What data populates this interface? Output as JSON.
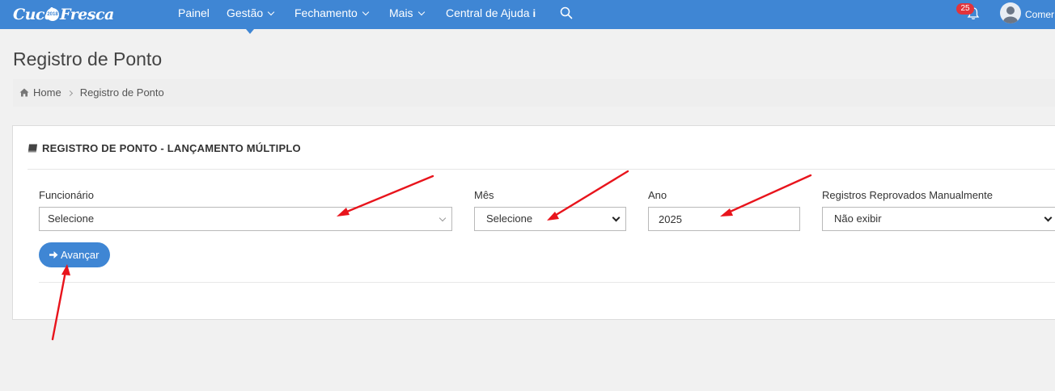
{
  "brand": {
    "logo_part1": "Cucá",
    "logo_badge": "2018",
    "logo_part2": "Fresca"
  },
  "nav": {
    "items": [
      {
        "label": "Painel"
      },
      {
        "label": "Gestão"
      },
      {
        "label": "Fechamento"
      },
      {
        "label": "Mais"
      },
      {
        "label": "Central de Ajuda"
      }
    ],
    "info_glyph": "i"
  },
  "header": {
    "notification_count": "25",
    "user_name": "Comer"
  },
  "page": {
    "title": "Registro de Ponto"
  },
  "breadcrumb": {
    "home": "Home",
    "current": "Registro de Ponto"
  },
  "panel": {
    "title": "REGISTRO DE PONTO - LANÇAMENTO MÚLTIPLO",
    "fields": {
      "funcionario": {
        "label": "Funcionário",
        "value": "Selecione"
      },
      "mes": {
        "label": "Mês",
        "value": "Selecione"
      },
      "ano": {
        "label": "Ano",
        "value": "2025"
      },
      "reprovados": {
        "label": "Registros Reprovados Manualmente",
        "value": "Não exibir"
      }
    },
    "submit_label": "Avançar"
  },
  "colors": {
    "primary": "#3f86d4",
    "badge": "#e2343c",
    "annotation": "#e8141c",
    "background": "#f1f1f1"
  },
  "icons": [
    "search-icon",
    "bell-icon",
    "avatar-icon",
    "home-icon",
    "book-icon",
    "arrow-right-icon",
    "chevron-down-icon",
    "info-icon"
  ]
}
